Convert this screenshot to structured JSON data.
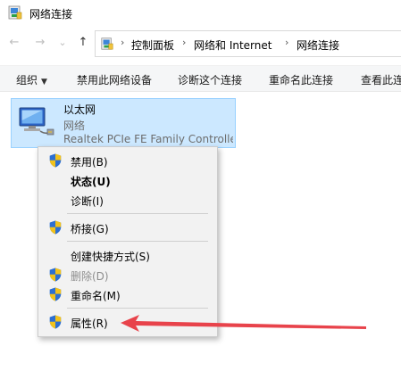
{
  "window": {
    "title": "网络连接"
  },
  "nav": {
    "back_glyph": "←",
    "forward_glyph": "→",
    "history_glyph": "⌄",
    "up_glyph": "↑"
  },
  "address": {
    "separator": "›",
    "crumbs": [
      "控制面板",
      "网络和 Internet",
      "网络连接"
    ]
  },
  "toolbar": {
    "organize": "组织",
    "organize_caret": "▼",
    "items": [
      "禁用此网络设备",
      "诊断这个连接",
      "重命名此连接",
      "查看此连"
    ]
  },
  "adapter": {
    "name": "以太网",
    "network": "网络",
    "device": "Realtek PCIe FE Family Controller",
    "selected": true
  },
  "context_menu": {
    "items": [
      {
        "label": "禁用(B)",
        "icon": "shield-icon",
        "bold": false,
        "disabled": false
      },
      {
        "label": "状态(U)",
        "icon": "",
        "bold": true,
        "disabled": false
      },
      {
        "label": "诊断(I)",
        "icon": "",
        "bold": false,
        "disabled": false
      },
      {
        "label": "桥接(G)",
        "icon": "shield-icon",
        "bold": false,
        "disabled": false
      },
      {
        "label": "创建快捷方式(S)",
        "icon": "",
        "bold": false,
        "disabled": false
      },
      {
        "label": "删除(D)",
        "icon": "shield-icon",
        "bold": false,
        "disabled": true
      },
      {
        "label": "重命名(M)",
        "icon": "shield-icon",
        "bold": false,
        "disabled": false
      },
      {
        "label": "属性(R)",
        "icon": "shield-icon",
        "bold": false,
        "disabled": false
      }
    ]
  },
  "colors": {
    "selection_fill": "#cce8ff",
    "selection_border": "#99d1ff",
    "annotation_arrow": "#e8434b",
    "shield_blue": "#2d6fd1",
    "shield_yellow": "#f2c21b"
  },
  "annotation": {
    "points_to": "属性(R)"
  }
}
